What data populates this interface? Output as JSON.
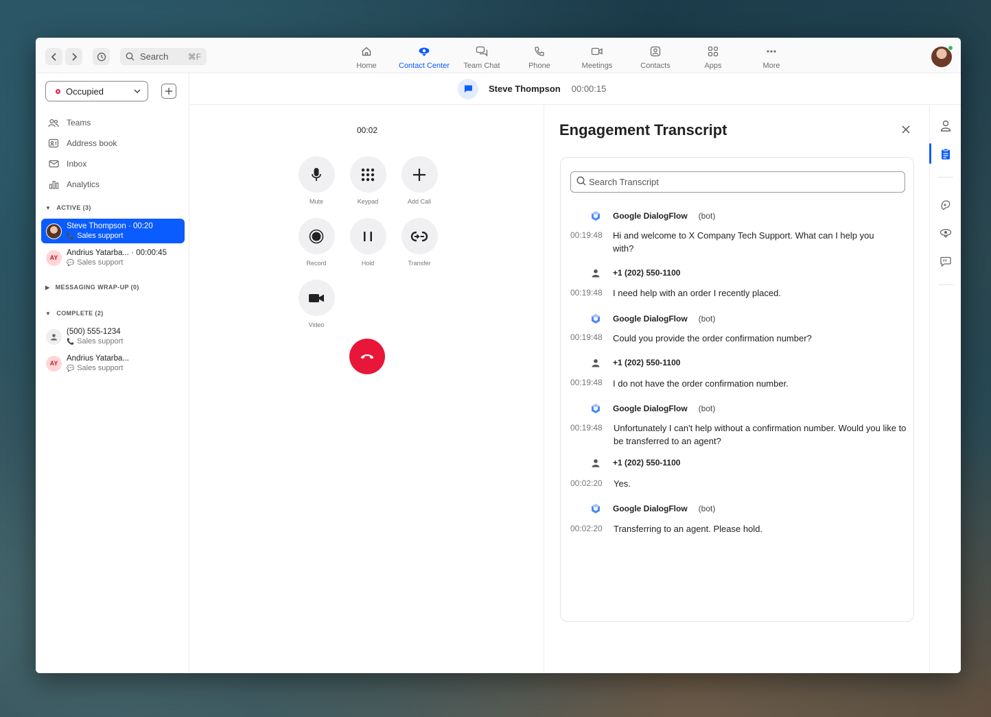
{
  "topbar": {
    "search_label": "Search",
    "search_shortcut": "⌘F",
    "tabs": [
      {
        "label": "Home",
        "icon": "home-icon"
      },
      {
        "label": "Contact Center",
        "icon": "contact-center-icon"
      },
      {
        "label": "Team Chat",
        "icon": "team-chat-icon"
      },
      {
        "label": "Phone",
        "icon": "phone-icon"
      },
      {
        "label": "Meetings",
        "icon": "meetings-icon"
      },
      {
        "label": "Contacts",
        "icon": "contacts-icon"
      },
      {
        "label": "Apps",
        "icon": "apps-icon"
      },
      {
        "label": "More",
        "icon": "more-icon"
      }
    ],
    "active_tab": "Contact Center",
    "accent_color": "#0b5cff"
  },
  "sidebar": {
    "status": "Occupied",
    "nav": [
      {
        "label": "Teams",
        "icon": "teams-icon"
      },
      {
        "label": "Address book",
        "icon": "address-book-icon"
      },
      {
        "label": "Inbox",
        "icon": "inbox-icon"
      },
      {
        "label": "Analytics",
        "icon": "analytics-icon"
      }
    ],
    "active_header": "ACTIVE (3)",
    "active_items": [
      {
        "line1": "Steve Thompson · 00:20",
        "line2": "Sales support",
        "channel": "phone"
      },
      {
        "initials": "AY",
        "line1": "Andrius Yatarba... · 00:00:45",
        "line2": "Sales support",
        "channel": "chat"
      }
    ],
    "wrapup_header": "MESSAGING WRAP-UP (0)",
    "complete_header": "COMPLETE (2)",
    "complete_items": [
      {
        "line1": "(500) 555-1234",
        "line2": "Sales support",
        "channel": "phone"
      },
      {
        "initials": "AY",
        "line1": "Andrius Yatarba...",
        "line2": "Sales support",
        "channel": "chat"
      }
    ]
  },
  "call": {
    "contact_name": "Steve Thompson",
    "header_timer": "00:00:15",
    "elapsed": "00:02",
    "controls": [
      {
        "label": "Mute",
        "icon": "microphone-icon"
      },
      {
        "label": "Keypad",
        "icon": "keypad-icon"
      },
      {
        "label": "Add Call",
        "icon": "plus-icon"
      },
      {
        "label": "Record",
        "icon": "record-icon"
      },
      {
        "label": "Hold",
        "icon": "pause-icon"
      },
      {
        "label": "Transfer",
        "icon": "transfer-icon"
      },
      {
        "label": "Video",
        "icon": "video-icon"
      }
    ],
    "hangup_color": "#e8173a"
  },
  "transcript": {
    "title": "Engagement Transcript",
    "search_placeholder": "Search Transcript",
    "messages": [
      {
        "who": "Google DialogFlow",
        "tag": "(bot)",
        "time": "00:19:48",
        "text": "Hi and welcome to X Company Tech Support.  What can I help you with?"
      },
      {
        "who": "+1 (202) 550-1100",
        "tag": "",
        "time": "00:19:48",
        "text": "I need help with an order I recently placed."
      },
      {
        "who": "Google DialogFlow",
        "tag": "(bot)",
        "time": "00:19:48",
        "text": "Could you provide the order confirmation number?"
      },
      {
        "who": "+1 (202) 550-1100",
        "tag": "",
        "time": "00:19:48",
        "text": "I do not have the order confirmation number."
      },
      {
        "who": "Google DialogFlow",
        "tag": "(bot)",
        "time": "00:19:48",
        "text": "Unfortunately I can't help without a confirmation number. Would you like to be transferred to an agent?"
      },
      {
        "who": "+1 (202) 550-1100",
        "tag": "",
        "time": "00:02:20",
        "text": "Yes."
      },
      {
        "who": "Google DialogFlow",
        "tag": "(bot)",
        "time": "00:02:20",
        "text": "Transferring to an agent. Please hold."
      }
    ]
  }
}
